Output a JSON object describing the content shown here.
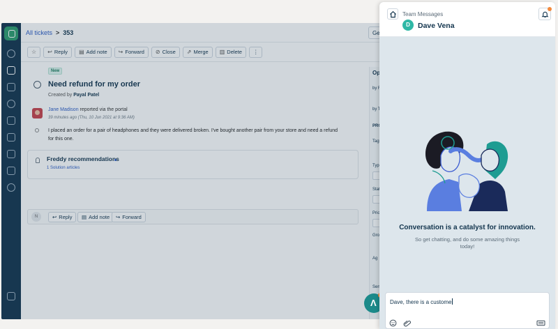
{
  "header": {
    "breadcrumb_link": "All tickets",
    "breadcrumb_sep": ">",
    "ticket_number": "353",
    "top_button": "Ge"
  },
  "toolbar": {
    "reply": "Reply",
    "add_note": "Add note",
    "forward": "Forward",
    "close": "Close",
    "merge": "Merge",
    "delete": "Delete",
    "more": "⋮"
  },
  "ticket": {
    "badge": "New",
    "subject": "Need refund for my order",
    "created_by_label": "Created by",
    "created_by": "Payal Patel",
    "reporter": "Jane Madison",
    "reported_via": "reported via the portal",
    "time_ago": "39 minutes ago (Thu, 10 Jun 2021 at 9:36 AM)",
    "body": "I placed an order for a pair of headphones and they were delivered broken. I've bought another pair from your store and need a refund for this one."
  },
  "freddy": {
    "title": "Freddy recommendations",
    "link": "1 Solution articles"
  },
  "reply_bar": {
    "avatar_initial": "N",
    "reply": "Reply",
    "add_note": "Add note",
    "forward": "Forward"
  },
  "properties": {
    "heading": "Op",
    "row1": "by F",
    "row2": "by T",
    "section": "PRO",
    "tags": "Tags",
    "type": "Type",
    "status": "Stat",
    "priority": "Prior",
    "group": "Grou",
    "agent": "Ag",
    "sent": "Sent"
  },
  "team_messages": {
    "title": "Team Messages",
    "contact_initial": "D",
    "contact_name": "Dave Vena",
    "tagline": "Conversation is a catalyst for innovation.",
    "subline": "So get chatting, and do some amazing things today!",
    "compose_text": "Dave, there is a custome"
  },
  "colors": {
    "rail": "#12344d",
    "accent": "#2c5cc5",
    "panel_bg": "#dde6ec",
    "contact_avatar": "#2fb8a6",
    "notification": "#f48a3c"
  }
}
